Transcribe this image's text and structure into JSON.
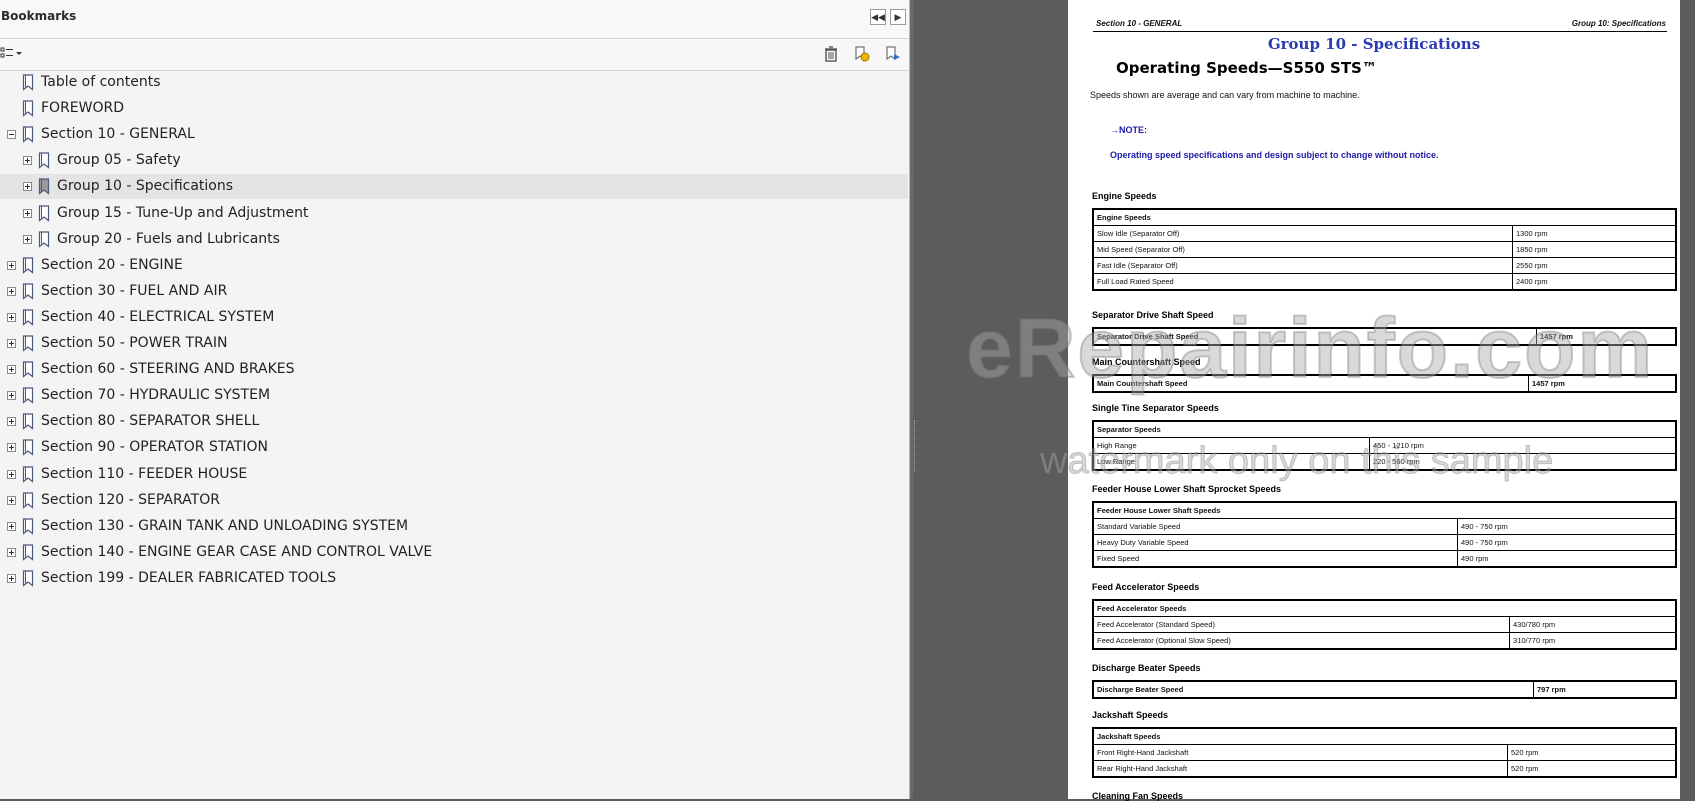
{
  "panel": {
    "title": "Bookmarks",
    "collapse_icon": "double-chevron-left-icon",
    "next_icon": "chevron-right-icon",
    "options_icon": "options-menu-icon",
    "delete_icon": "trash-icon",
    "new_bookmark_icon": "new-bookmark-icon",
    "expand_bookmark_icon": "expand-current-bookmark-icon"
  },
  "tree": [
    {
      "label": "Table of contents",
      "level": 0,
      "expander": "none",
      "selected": false
    },
    {
      "label": "FOREWORD",
      "level": 0,
      "expander": "none",
      "selected": false
    },
    {
      "label": "Section 10 - GENERAL",
      "level": 0,
      "expander": "minus",
      "selected": false
    },
    {
      "label": "Group 05 - Safety",
      "level": 1,
      "expander": "plus",
      "selected": false
    },
    {
      "label": "Group 10 - Specifications",
      "level": 1,
      "expander": "plus",
      "selected": true
    },
    {
      "label": "Group 15 - Tune-Up and Adjustment",
      "level": 1,
      "expander": "plus",
      "selected": false
    },
    {
      "label": "Group 20 - Fuels and Lubricants",
      "level": 1,
      "expander": "plus",
      "selected": false
    },
    {
      "label": "Section 20 - ENGINE",
      "level": 0,
      "expander": "plus",
      "selected": false
    },
    {
      "label": "Section 30 - FUEL AND AIR",
      "level": 0,
      "expander": "plus",
      "selected": false
    },
    {
      "label": "Section 40 - ELECTRICAL SYSTEM",
      "level": 0,
      "expander": "plus",
      "selected": false
    },
    {
      "label": "Section 50 - POWER TRAIN",
      "level": 0,
      "expander": "plus",
      "selected": false
    },
    {
      "label": "Section 60 - STEERING AND BRAKES",
      "level": 0,
      "expander": "plus",
      "selected": false
    },
    {
      "label": "Section 70 - HYDRAULIC SYSTEM",
      "level": 0,
      "expander": "plus",
      "selected": false
    },
    {
      "label": "Section 80 - SEPARATOR SHELL",
      "level": 0,
      "expander": "plus",
      "selected": false
    },
    {
      "label": "Section 90 - OPERATOR STATION",
      "level": 0,
      "expander": "plus",
      "selected": false
    },
    {
      "label": "Section 110 - FEEDER HOUSE",
      "level": 0,
      "expander": "plus",
      "selected": false
    },
    {
      "label": "Section 120 - SEPARATOR",
      "level": 0,
      "expander": "plus",
      "selected": false
    },
    {
      "label": "Section 130 - GRAIN TANK AND UNLOADING SYSTEM",
      "level": 0,
      "expander": "plus",
      "selected": false
    },
    {
      "label": "Section 140 - ENGINE GEAR CASE AND CONTROL VALVE",
      "level": 0,
      "expander": "plus",
      "selected": false
    },
    {
      "label": "Section 199 - DEALER FABRICATED TOOLS",
      "level": 0,
      "expander": "plus",
      "selected": false
    }
  ],
  "page": {
    "header_left": "Section 10 - GENERAL",
    "header_right": "Group 10: Specifications",
    "group_title": "Group 10 - Specifications",
    "title": "Operating Speeds—S550 STS™",
    "intro": "Speeds shown are average and can vary from machine to machine.",
    "note_label": "→NOTE:",
    "note_text": "Operating speed specifications and design subject to change without notice.",
    "sections": [
      {
        "heading": "Engine Speeds",
        "table_title": "Engine Speeds",
        "rows": [
          [
            "Slow Idle (Separator Off)",
            "1300 rpm"
          ],
          [
            "Mid Speed (Separator Off)",
            "1850 rpm"
          ],
          [
            "Fast Idle (Separator Off)",
            "2550 rpm"
          ],
          [
            "Full Load Rated Speed",
            "2400 rpm"
          ]
        ]
      },
      {
        "heading": "Separator Drive Shaft Speed",
        "table_title": "",
        "rows": [
          [
            "Separator Drive Shaft Speed",
            "1457 rpm"
          ]
        ]
      },
      {
        "heading": "Main Countershaft Speed",
        "table_title": "",
        "rows": [
          [
            "Main Countershaft Speed",
            "1457 rpm"
          ]
        ]
      },
      {
        "heading": "Single Tine Separator Speeds",
        "table_title": "Separator Speeds",
        "rows": [
          [
            "High Range",
            "450 - 1210 rpm"
          ],
          [
            "Low Range",
            "220 - 560 rpm"
          ]
        ]
      },
      {
        "heading": "Feeder House Lower Shaft Sprocket Speeds",
        "table_title": "Feeder House Lower Shaft Speeds",
        "rows": [
          [
            "Standard Variable Speed",
            "490 - 750 rpm"
          ],
          [
            "Heavy Duty Variable Speed",
            "490 - 750 rpm"
          ],
          [
            "Fixed Speed",
            "490 rpm"
          ]
        ]
      },
      {
        "heading": "Feed Accelerator Speeds",
        "table_title": "Feed Accelerator Speeds",
        "rows": [
          [
            "Feed Accelerator (Standard Speed)",
            "430/780 rpm"
          ],
          [
            "Feed Accelerator (Optional Slow Speed)",
            "310/770 rpm"
          ]
        ]
      },
      {
        "heading": "Discharge Beater Speeds",
        "table_title": "",
        "rows": [
          [
            "Discharge Beater Speed",
            "797 rpm"
          ]
        ]
      },
      {
        "heading": "Jackshaft Speeds",
        "table_title": "Jackshaft Speeds",
        "rows": [
          [
            "Front Right-Hand Jackshaft",
            "520 rpm"
          ],
          [
            "Rear Right-Hand Jackshaft",
            "520 rpm"
          ]
        ]
      },
      {
        "heading": "Cleaning Fan Speeds",
        "table_title": "",
        "rows": []
      }
    ]
  },
  "watermark": {
    "line1": "eRepairinfo.com",
    "line2": "watermark only on this sample"
  }
}
